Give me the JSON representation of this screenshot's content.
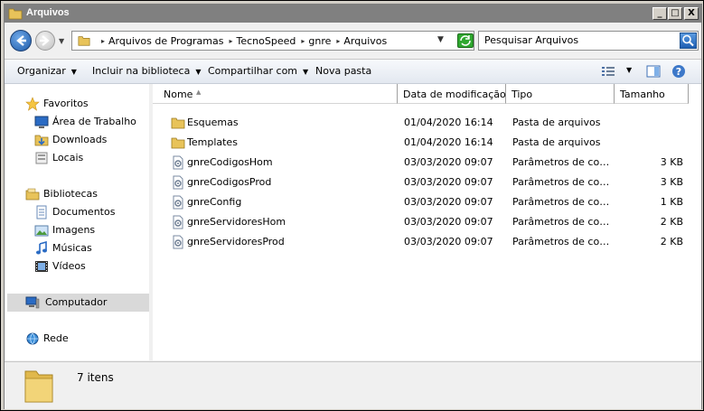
{
  "window": {
    "title": "Arquivos",
    "buttons": [
      "_",
      "□",
      "X"
    ]
  },
  "address": {
    "breadcrumbs": [
      "Arquivos de Programas",
      "TecnoSpeed",
      "gnre",
      "Arquivos"
    ],
    "search_placeholder": "Pesquisar Arquivos"
  },
  "toolbar": {
    "organize_label": "Organizar",
    "include_label": "Incluir na biblioteca",
    "share_label": "Compartilhar com",
    "new_folder_label": "Nova pasta"
  },
  "sidebar": {
    "favorites_label": "Favoritos",
    "favorites": [
      "Área de Trabalho",
      "Downloads",
      "Locais"
    ],
    "libraries_label": "Bibliotecas",
    "libraries": [
      "Documentos",
      "Imagens",
      "Músicas",
      "Vídeos"
    ],
    "computer_label": "Computador",
    "network_label": "Rede"
  },
  "columns": {
    "name": "Nome",
    "date": "Data de modificação",
    "type": "Tipo",
    "size": "Tamanho"
  },
  "files": [
    {
      "name": "Esquemas",
      "date": "01/04/2020 16:14",
      "type": "Pasta de arquivos",
      "size": "",
      "kind": "folder"
    },
    {
      "name": "Templates",
      "date": "01/04/2020 16:14",
      "type": "Pasta de arquivos",
      "size": "",
      "kind": "folder"
    },
    {
      "name": "gnreCodigosHom",
      "date": "03/03/2020 09:07",
      "type": "Parâmetros de confi...",
      "size": "3 KB",
      "kind": "config"
    },
    {
      "name": "gnreCodigosProd",
      "date": "03/03/2020 09:07",
      "type": "Parâmetros de confi...",
      "size": "3 KB",
      "kind": "config"
    },
    {
      "name": "gnreConfig",
      "date": "03/03/2020 09:07",
      "type": "Parâmetros de confi...",
      "size": "1 KB",
      "kind": "config"
    },
    {
      "name": "gnreServidoresHom",
      "date": "03/03/2020 09:07",
      "type": "Parâmetros de confi...",
      "size": "2 KB",
      "kind": "config"
    },
    {
      "name": "gnreServidoresProd",
      "date": "03/03/2020 09:07",
      "type": "Parâmetros de confi...",
      "size": "2 KB",
      "kind": "config"
    }
  ],
  "details": {
    "count_text": "7 itens"
  }
}
